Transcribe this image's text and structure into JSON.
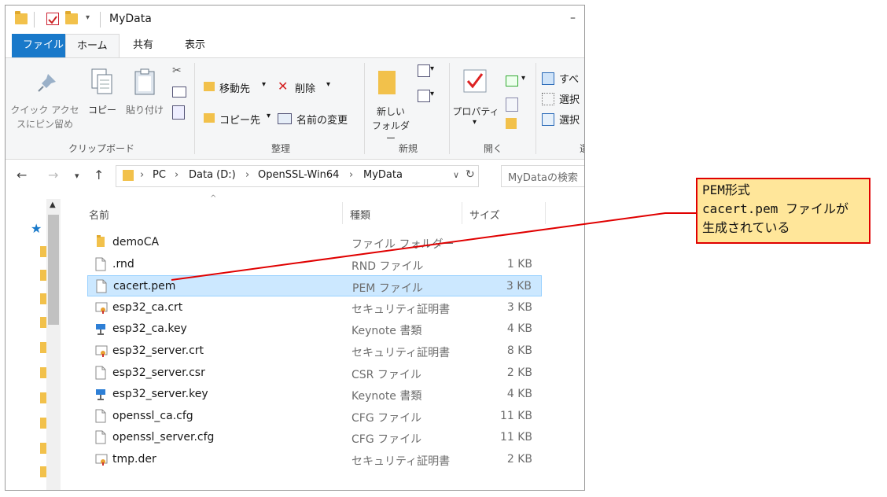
{
  "window": {
    "title": "MyData",
    "minimize_glyph": "–"
  },
  "ribbon": {
    "tabs": [
      "ファイル",
      "ホーム",
      "共有",
      "表示"
    ],
    "clipboard": {
      "pin_label_line1": "クイック アクセ",
      "pin_label_line2": "スにピン留め",
      "copy_label": "コピー",
      "paste_label": "貼り付け",
      "group_label": "クリップボード"
    },
    "organize": {
      "move_to": "移動先",
      "delete": "削除",
      "copy_to": "コピー先",
      "rename": "名前の変更",
      "group_label": "整理"
    },
    "new": {
      "new_folder_line1": "新しい",
      "new_folder_line2": "フォルダー",
      "group_label": "新規"
    },
    "open": {
      "properties": "プロパティ",
      "group_label": "開く"
    },
    "select": {
      "select_all": "すべ",
      "select_none": "選択",
      "invert_select": "選択",
      "group_label": "選"
    }
  },
  "address": {
    "path": [
      "PC",
      "Data (D:)",
      "OpenSSL-Win64",
      "MyData"
    ],
    "search_placeholder": "MyDataの検索"
  },
  "columns": {
    "name": "名前",
    "type": "種類",
    "size": "サイズ"
  },
  "files": [
    {
      "name": "demoCA",
      "type": "ファイル フォルダー",
      "size": "",
      "icon": "folder-icon",
      "selected": false
    },
    {
      "name": ".rnd",
      "type": "RND ファイル",
      "size": "1 KB",
      "icon": "file-icon",
      "selected": false
    },
    {
      "name": "cacert.pem",
      "type": "PEM ファイル",
      "size": "3 KB",
      "icon": "file-icon",
      "selected": true
    },
    {
      "name": "esp32_ca.crt",
      "type": "セキュリティ証明書",
      "size": "3 KB",
      "icon": "certificate-icon",
      "selected": false
    },
    {
      "name": "esp32_ca.key",
      "type": "Keynote 書類",
      "size": "4 KB",
      "icon": "keynote-icon",
      "selected": false
    },
    {
      "name": "esp32_server.crt",
      "type": "セキュリティ証明書",
      "size": "8 KB",
      "icon": "certificate-icon",
      "selected": false
    },
    {
      "name": "esp32_server.csr",
      "type": "CSR ファイル",
      "size": "2 KB",
      "icon": "file-icon",
      "selected": false
    },
    {
      "name": "esp32_server.key",
      "type": "Keynote 書類",
      "size": "4 KB",
      "icon": "keynote-icon",
      "selected": false
    },
    {
      "name": "openssl_ca.cfg",
      "type": "CFG ファイル",
      "size": "11 KB",
      "icon": "file-icon",
      "selected": false
    },
    {
      "name": "openssl_server.cfg",
      "type": "CFG ファイル",
      "size": "11 KB",
      "icon": "file-icon",
      "selected": false
    },
    {
      "name": "tmp.der",
      "type": "セキュリティ証明書",
      "size": "2 KB",
      "icon": "certificate-icon",
      "selected": false
    }
  ],
  "callout": {
    "line1": "PEM形式",
    "line2": "cacert.pem ファイルが",
    "line3": "生成されている"
  },
  "colors": {
    "file_tab": "#1979ca",
    "selection": "#cce8ff",
    "callout_border": "#e00000",
    "callout_fill": "#ffe69a",
    "folder": "#f2c14b"
  }
}
